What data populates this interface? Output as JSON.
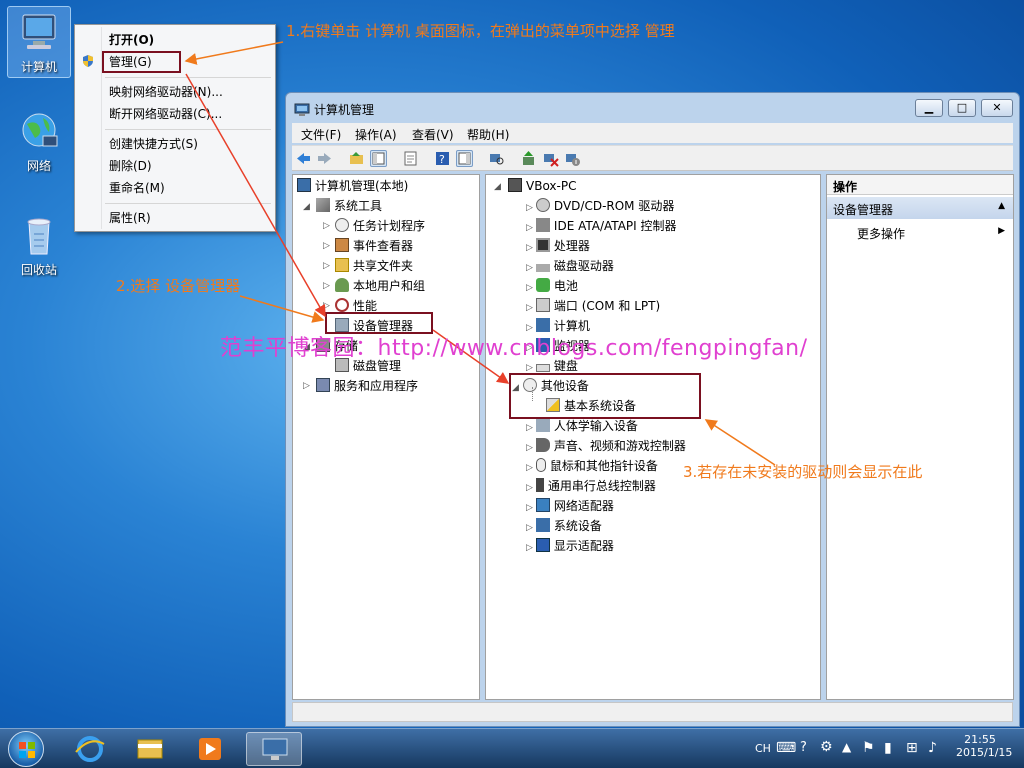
{
  "desktop": {
    "icons": [
      {
        "label": "计算机"
      },
      {
        "label": "网络"
      },
      {
        "label": "回收站"
      }
    ]
  },
  "context_menu": {
    "items": [
      "打开(O)",
      "管理(G)",
      "映射网络驱动器(N)...",
      "断开网络驱动器(C)...",
      "创建快捷方式(S)",
      "删除(D)",
      "重命名(M)",
      "属性(R)"
    ]
  },
  "annotations": {
    "step1": "1.右键单击 计算机 桌面图标，在弹出的菜单项中选择 管理",
    "step2": "2.选择 设备管理器",
    "step3": "3.若存在未安装的驱动则会显示在此",
    "watermark": "范丰平博客园：http://www.cnblogs.com/fengpingfan/"
  },
  "window": {
    "title": "计算机管理",
    "menu": [
      "文件(F)",
      "操作(A)",
      "查看(V)",
      "帮助(H)"
    ],
    "left_tree": [
      "计算机管理(本地)",
      "系统工具",
      "任务计划程序",
      "事件查看器",
      "共享文件夹",
      "本地用户和组",
      "性能",
      "设备管理器",
      "存储",
      "磁盘管理",
      "服务和应用程序"
    ],
    "device_tree": [
      "VBox-PC",
      "DVD/CD-ROM 驱动器",
      "IDE ATA/ATAPI 控制器",
      "处理器",
      "磁盘驱动器",
      "电池",
      "端口 (COM 和 LPT)",
      "计算机",
      "监视器",
      "键盘",
      "其他设备",
      "基本系统设备",
      "人体学输入设备",
      "声音、视频和游戏控制器",
      "鼠标和其他指针设备",
      "通用串行总线控制器",
      "网络适配器",
      "系统设备",
      "显示适配器"
    ],
    "actions": {
      "header": "操作",
      "section": "设备管理器",
      "more": "更多操作"
    }
  },
  "taskbar": {
    "lang": "CH",
    "time": "21:55",
    "date": "2015/1/15"
  },
  "colors": {
    "annotation": "#f07a1c",
    "highlight_box": "#7a1020",
    "watermark": "#e040d0",
    "arrow_red": "#e8402a"
  }
}
